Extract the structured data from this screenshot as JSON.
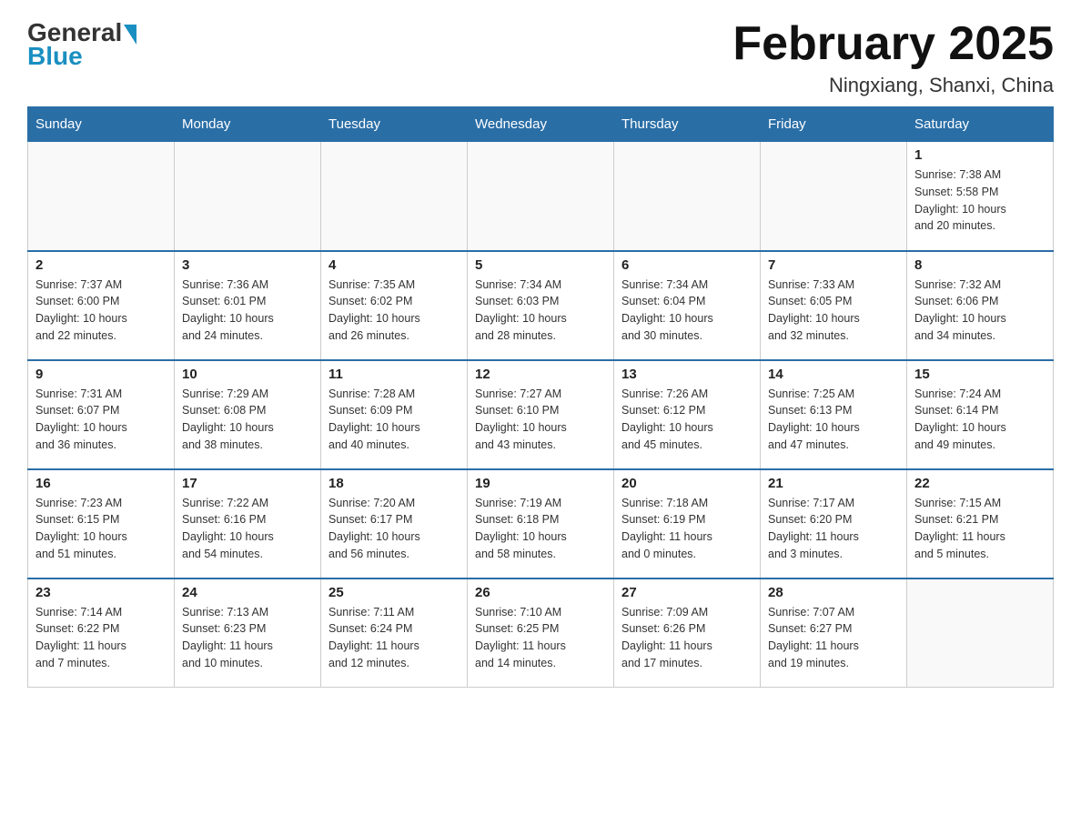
{
  "header": {
    "logo_general": "General",
    "logo_blue": "Blue",
    "month_title": "February 2025",
    "location": "Ningxiang, Shanxi, China"
  },
  "weekdays": [
    "Sunday",
    "Monday",
    "Tuesday",
    "Wednesday",
    "Thursday",
    "Friday",
    "Saturday"
  ],
  "weeks": [
    [
      {
        "day": "",
        "info": ""
      },
      {
        "day": "",
        "info": ""
      },
      {
        "day": "",
        "info": ""
      },
      {
        "day": "",
        "info": ""
      },
      {
        "day": "",
        "info": ""
      },
      {
        "day": "",
        "info": ""
      },
      {
        "day": "1",
        "info": "Sunrise: 7:38 AM\nSunset: 5:58 PM\nDaylight: 10 hours\nand 20 minutes."
      }
    ],
    [
      {
        "day": "2",
        "info": "Sunrise: 7:37 AM\nSunset: 6:00 PM\nDaylight: 10 hours\nand 22 minutes."
      },
      {
        "day": "3",
        "info": "Sunrise: 7:36 AM\nSunset: 6:01 PM\nDaylight: 10 hours\nand 24 minutes."
      },
      {
        "day": "4",
        "info": "Sunrise: 7:35 AM\nSunset: 6:02 PM\nDaylight: 10 hours\nand 26 minutes."
      },
      {
        "day": "5",
        "info": "Sunrise: 7:34 AM\nSunset: 6:03 PM\nDaylight: 10 hours\nand 28 minutes."
      },
      {
        "day": "6",
        "info": "Sunrise: 7:34 AM\nSunset: 6:04 PM\nDaylight: 10 hours\nand 30 minutes."
      },
      {
        "day": "7",
        "info": "Sunrise: 7:33 AM\nSunset: 6:05 PM\nDaylight: 10 hours\nand 32 minutes."
      },
      {
        "day": "8",
        "info": "Sunrise: 7:32 AM\nSunset: 6:06 PM\nDaylight: 10 hours\nand 34 minutes."
      }
    ],
    [
      {
        "day": "9",
        "info": "Sunrise: 7:31 AM\nSunset: 6:07 PM\nDaylight: 10 hours\nand 36 minutes."
      },
      {
        "day": "10",
        "info": "Sunrise: 7:29 AM\nSunset: 6:08 PM\nDaylight: 10 hours\nand 38 minutes."
      },
      {
        "day": "11",
        "info": "Sunrise: 7:28 AM\nSunset: 6:09 PM\nDaylight: 10 hours\nand 40 minutes."
      },
      {
        "day": "12",
        "info": "Sunrise: 7:27 AM\nSunset: 6:10 PM\nDaylight: 10 hours\nand 43 minutes."
      },
      {
        "day": "13",
        "info": "Sunrise: 7:26 AM\nSunset: 6:12 PM\nDaylight: 10 hours\nand 45 minutes."
      },
      {
        "day": "14",
        "info": "Sunrise: 7:25 AM\nSunset: 6:13 PM\nDaylight: 10 hours\nand 47 minutes."
      },
      {
        "day": "15",
        "info": "Sunrise: 7:24 AM\nSunset: 6:14 PM\nDaylight: 10 hours\nand 49 minutes."
      }
    ],
    [
      {
        "day": "16",
        "info": "Sunrise: 7:23 AM\nSunset: 6:15 PM\nDaylight: 10 hours\nand 51 minutes."
      },
      {
        "day": "17",
        "info": "Sunrise: 7:22 AM\nSunset: 6:16 PM\nDaylight: 10 hours\nand 54 minutes."
      },
      {
        "day": "18",
        "info": "Sunrise: 7:20 AM\nSunset: 6:17 PM\nDaylight: 10 hours\nand 56 minutes."
      },
      {
        "day": "19",
        "info": "Sunrise: 7:19 AM\nSunset: 6:18 PM\nDaylight: 10 hours\nand 58 minutes."
      },
      {
        "day": "20",
        "info": "Sunrise: 7:18 AM\nSunset: 6:19 PM\nDaylight: 11 hours\nand 0 minutes."
      },
      {
        "day": "21",
        "info": "Sunrise: 7:17 AM\nSunset: 6:20 PM\nDaylight: 11 hours\nand 3 minutes."
      },
      {
        "day": "22",
        "info": "Sunrise: 7:15 AM\nSunset: 6:21 PM\nDaylight: 11 hours\nand 5 minutes."
      }
    ],
    [
      {
        "day": "23",
        "info": "Sunrise: 7:14 AM\nSunset: 6:22 PM\nDaylight: 11 hours\nand 7 minutes."
      },
      {
        "day": "24",
        "info": "Sunrise: 7:13 AM\nSunset: 6:23 PM\nDaylight: 11 hours\nand 10 minutes."
      },
      {
        "day": "25",
        "info": "Sunrise: 7:11 AM\nSunset: 6:24 PM\nDaylight: 11 hours\nand 12 minutes."
      },
      {
        "day": "26",
        "info": "Sunrise: 7:10 AM\nSunset: 6:25 PM\nDaylight: 11 hours\nand 14 minutes."
      },
      {
        "day": "27",
        "info": "Sunrise: 7:09 AM\nSunset: 6:26 PM\nDaylight: 11 hours\nand 17 minutes."
      },
      {
        "day": "28",
        "info": "Sunrise: 7:07 AM\nSunset: 6:27 PM\nDaylight: 11 hours\nand 19 minutes."
      },
      {
        "day": "",
        "info": ""
      }
    ]
  ]
}
